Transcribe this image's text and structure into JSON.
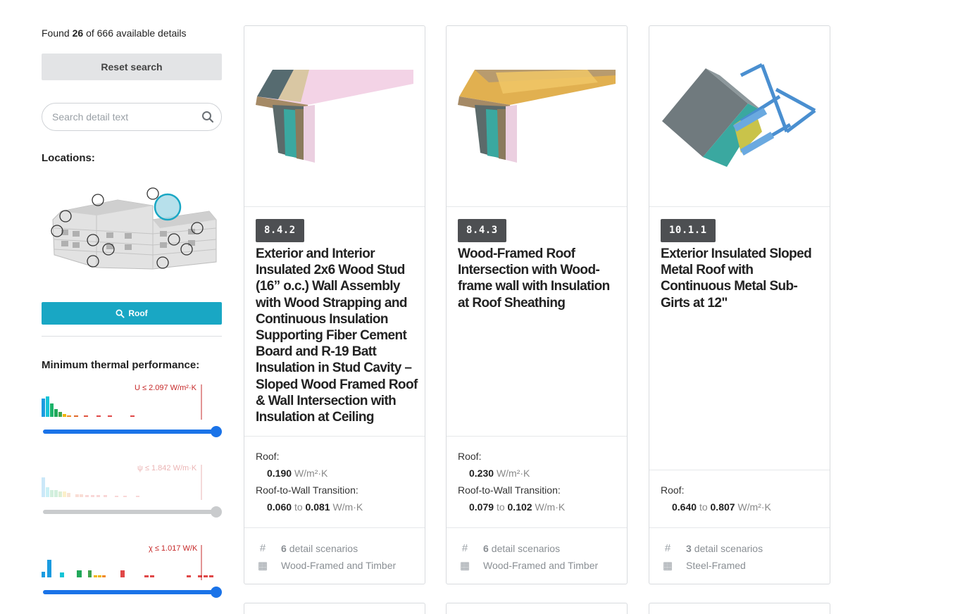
{
  "results": {
    "prefix": "Found",
    "count": "26",
    "suffix": "of 666 available details"
  },
  "reset_label": "Reset search",
  "search": {
    "placeholder": "Search detail text"
  },
  "locations": {
    "title": "Locations:",
    "button_label": "Roof"
  },
  "thermal": {
    "title": "Minimum thermal performance:",
    "u_label": "U ≤ 2.097 W/m²·K",
    "psi_label": "ψ ≤ 1.842 W/m·K",
    "chi_label": "χ ≤ 1.017 W/K",
    "u_slider_value": 1.0,
    "psi_slider_value": 1.0,
    "chi_slider_value": 1.0
  },
  "colors": {
    "accent": "#19a7c4",
    "slider": "#1a73e8",
    "badge": "#4d4f52",
    "limit_line": "#c62828"
  },
  "cards": [
    {
      "code": "8.4.2",
      "title": "Exterior and Interior Insulated 2x6 Wood Stud (16” o.c.) Wall Assembly with Wood Strapping and Continuous Insulation Supporting Fiber Cement Board and R-19 Batt Insulation in Stud Cavity – Sloped Wood Framed Roof & Wall Intersection with Insulation at Ceiling",
      "perf1_label": "Roof:",
      "perf1_value": "0.190",
      "perf1_unit": "W/m²·K",
      "perf2_label": "Roof-to-Wall Transition:",
      "perf2_min": "0.060",
      "perf2_to": "to",
      "perf2_max": "0.081",
      "perf2_unit": "W/m·K",
      "scenarios_count": "6",
      "scenarios_label": "detail scenarios",
      "category": "Wood-Framed and Timber"
    },
    {
      "code": "8.4.3",
      "title": "Wood-Framed Roof Intersection with Wood-frame wall with Insulation at Roof Sheathing",
      "perf1_label": "Roof:",
      "perf1_value": "0.230",
      "perf1_unit": "W/m²·K",
      "perf2_label": "Roof-to-Wall Transition:",
      "perf2_min": "0.079",
      "perf2_to": "to",
      "perf2_max": "0.102",
      "perf2_unit": "W/m·K",
      "scenarios_count": "6",
      "scenarios_label": "detail scenarios",
      "category": "Wood-Framed and Timber"
    },
    {
      "code": "10.1.1",
      "title": "Exterior Insulated Sloped Metal Roof with Continuous Metal Sub-Girts at 12\"",
      "perf1_label": "Roof:",
      "perf1_min": "0.640",
      "perf1_to": "to",
      "perf1_max": "0.807",
      "perf1_unit": "W/m²·K",
      "scenarios_count": "3",
      "scenarios_label": "detail scenarios",
      "category": "Steel-Framed"
    }
  ],
  "icons": {
    "search": "search-icon",
    "hash": "hash-icon",
    "grid": "grid-icon"
  }
}
